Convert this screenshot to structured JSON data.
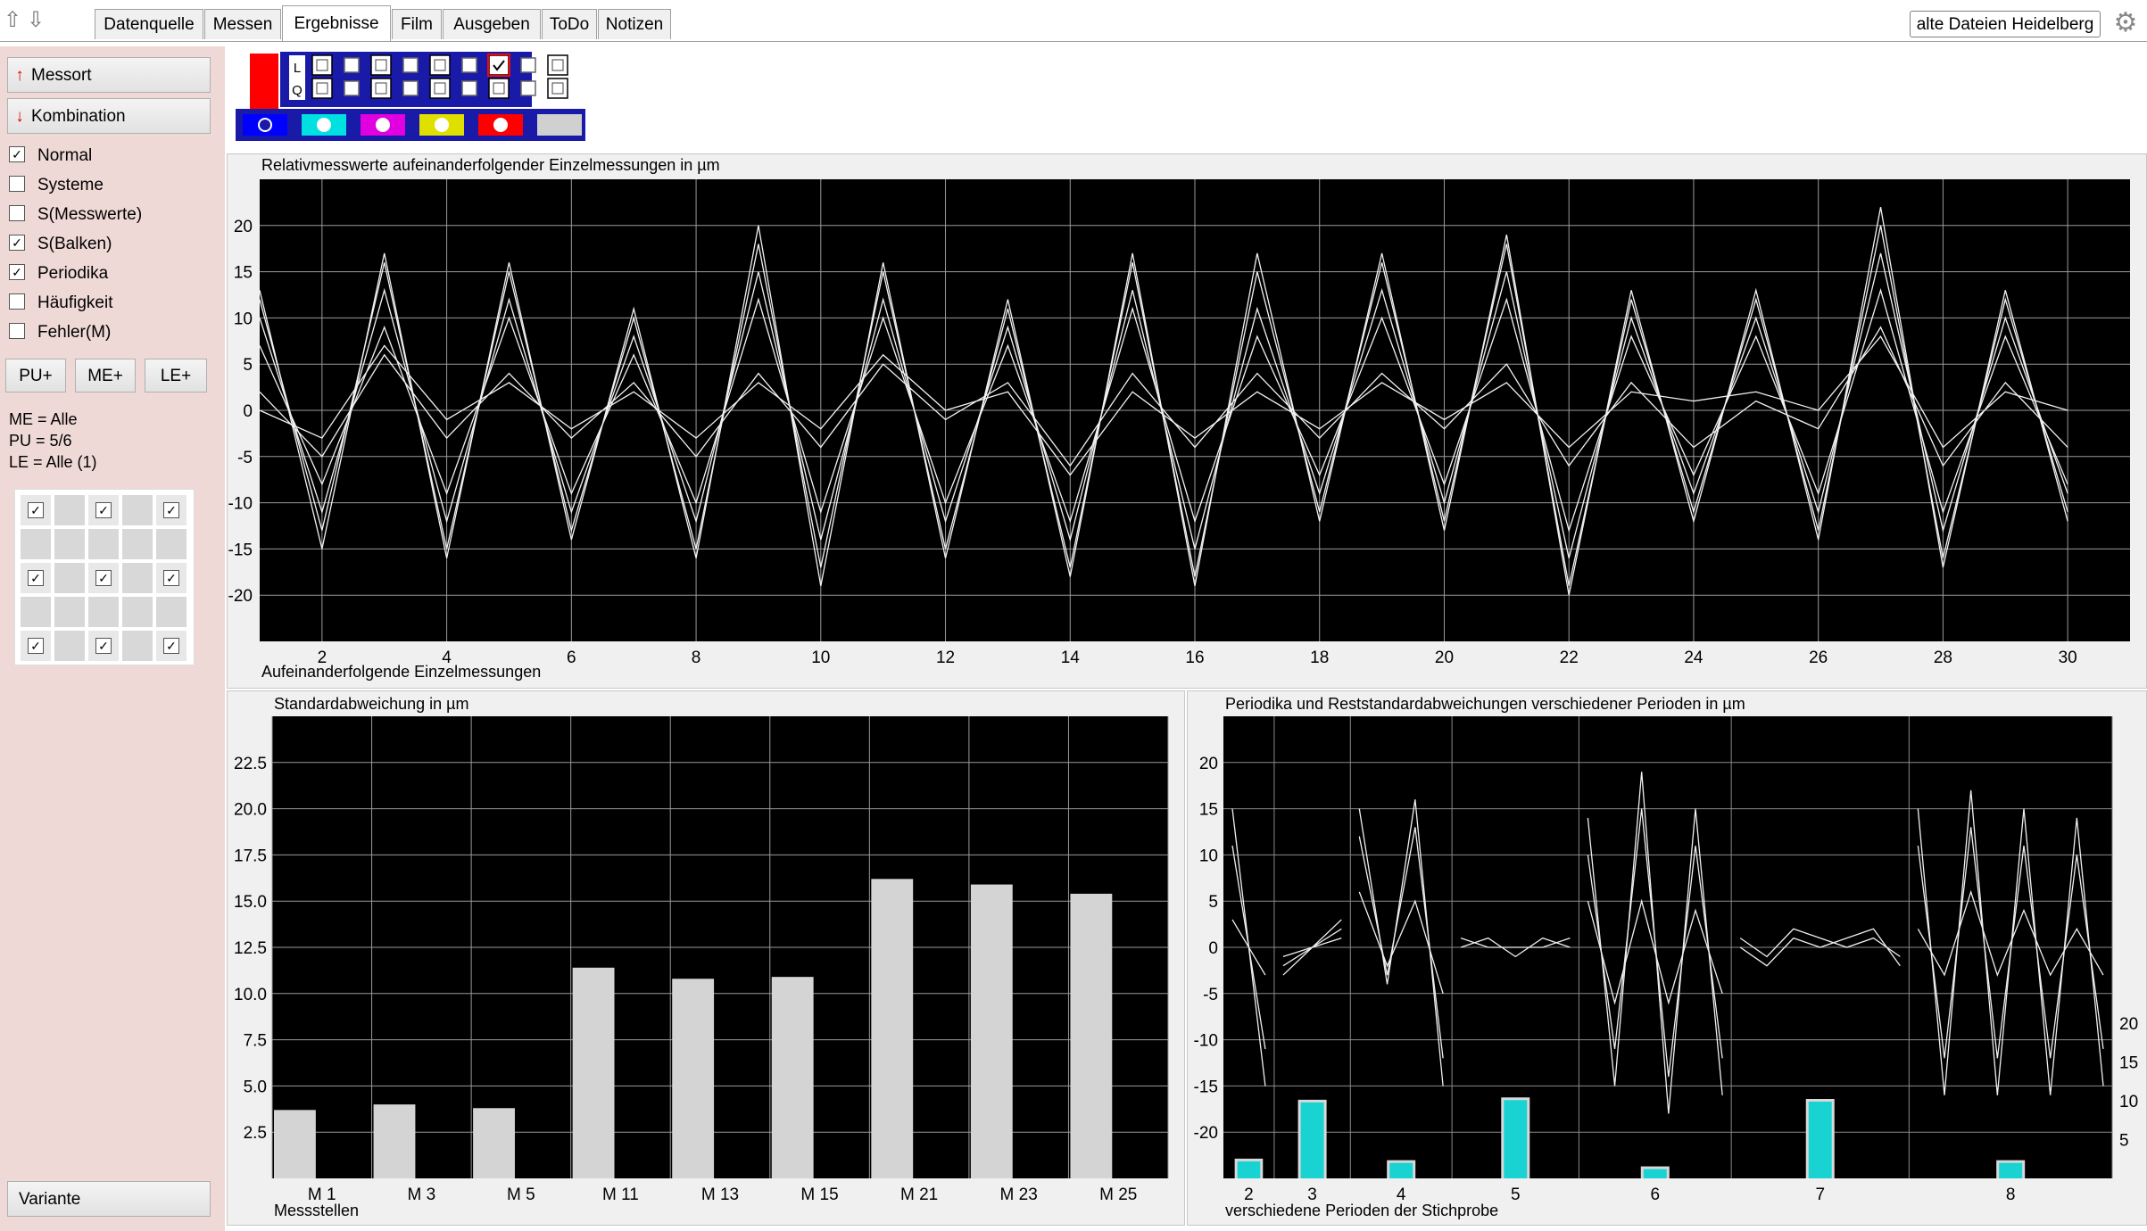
{
  "tabs": [
    {
      "label": "Datenquelle"
    },
    {
      "label": "Messen"
    },
    {
      "label": "Ergebnisse",
      "active": true
    },
    {
      "label": "Film"
    },
    {
      "label": "Ausgeben"
    },
    {
      "label": "ToDo"
    },
    {
      "label": "Notizen"
    }
  ],
  "datafile_label": "alte Dateien Heidelberg",
  "sidebar": {
    "messort_label": "Messort",
    "kombination_label": "Kombination",
    "checkboxes": [
      {
        "label": "Normal",
        "checked": true
      },
      {
        "label": "Systeme",
        "checked": false
      },
      {
        "label": "S(Messwerte)",
        "checked": false
      },
      {
        "label": "S(Balken)",
        "checked": true
      },
      {
        "label": "Periodika",
        "checked": true
      },
      {
        "label": "Häufigkeit",
        "checked": false
      },
      {
        "label": "Fehler(M)",
        "checked": false
      }
    ],
    "buttons": [
      "PU+",
      "ME+",
      "LE+"
    ],
    "info": [
      "ME = Alle",
      "PU = 5/6",
      "LE = Alle (1)"
    ],
    "variante_label": "Variante"
  },
  "legend": {
    "row_labels": [
      "L",
      "Q"
    ],
    "color_swatches": [
      "#0000ff",
      "#00e0e0",
      "#e000e0",
      "#e0e000",
      "#ff0000",
      "#d0d0d0"
    ]
  },
  "chart_data": [
    {
      "type": "line",
      "title": "Relativmesswerte aufeinanderfolgender Einzelmessungen in µm",
      "xlabel": "Aufeinanderfolgende Einzelmessungen",
      "ylabel": "",
      "xlim": [
        1,
        31
      ],
      "ylim": [
        -25,
        25
      ],
      "xticks": [
        2,
        4,
        6,
        8,
        10,
        12,
        14,
        16,
        18,
        20,
        22,
        24,
        26,
        28,
        30
      ],
      "yticks": [
        20,
        15,
        10,
        5,
        0,
        -5,
        -10,
        -15,
        -20
      ],
      "x": [
        1,
        2,
        3,
        4,
        5,
        6,
        7,
        8,
        9,
        10,
        11,
        12,
        13,
        14,
        15,
        16,
        17,
        18,
        19,
        20,
        21,
        22,
        23,
        24,
        25,
        26,
        27,
        28,
        29,
        30
      ],
      "series": [
        {
          "values": [
            13,
            -15,
            17,
            -16,
            16,
            -14,
            11,
            -16,
            20,
            -19,
            16,
            -16,
            12,
            -18,
            17,
            -19,
            17,
            -12,
            17,
            -13,
            19,
            -20,
            13,
            -12,
            13,
            -14,
            22,
            -17,
            13,
            -12
          ]
        },
        {
          "values": [
            12,
            -13,
            16,
            -15,
            15,
            -13,
            10,
            -15,
            18,
            -17,
            15,
            -15,
            11,
            -17,
            16,
            -18,
            15,
            -11,
            16,
            -12,
            18,
            -19,
            12,
            -11,
            12,
            -13,
            20,
            -16,
            12,
            -11
          ]
        },
        {
          "values": [
            10,
            -11,
            13,
            -12,
            12,
            -11,
            8,
            -12,
            15,
            -14,
            12,
            -12,
            9,
            -14,
            13,
            -15,
            11,
            -9,
            13,
            -10,
            15,
            -16,
            10,
            -9,
            10,
            -11,
            17,
            -13,
            10,
            -9
          ]
        },
        {
          "values": [
            7,
            -8,
            9,
            -9,
            10,
            -9,
            6,
            -10,
            12,
            -11,
            10,
            -10,
            7,
            -12,
            11,
            -12,
            8,
            -7,
            10,
            -8,
            12,
            -13,
            8,
            -7,
            8,
            -9,
            13,
            -11,
            8,
            -8
          ]
        },
        {
          "values": [
            2,
            -5,
            6,
            -3,
            4,
            -3,
            3,
            -5,
            4,
            -4,
            5,
            -1,
            3,
            -6,
            4,
            -4,
            4,
            -3,
            4,
            -2,
            5,
            -6,
            3,
            -4,
            1,
            -2,
            9,
            -6,
            3,
            -4
          ]
        },
        {
          "values": [
            0,
            -3,
            7,
            -1,
            3,
            -2,
            2,
            -3,
            3,
            -2,
            6,
            0,
            2,
            -7,
            2,
            -3,
            2,
            -2,
            3,
            -1,
            3,
            -4,
            2,
            1,
            2,
            0,
            8,
            -4,
            2,
            0
          ]
        }
      ]
    },
    {
      "type": "bar",
      "title": "Standardabweichung in µm",
      "xlabel": "Messstellen",
      "ylabel": "",
      "categories": [
        "M 1",
        "M 3",
        "M 5",
        "M 11",
        "M 13",
        "M 15",
        "M 21",
        "M 23",
        "M 25"
      ],
      "values": [
        3.7,
        4.0,
        3.8,
        11.4,
        10.8,
        10.9,
        16.2,
        15.9,
        15.4
      ],
      "ylim": [
        0,
        25
      ],
      "yticks": [
        "2.5",
        "5.0",
        "7.5",
        "10.0",
        "12.5",
        "15.0",
        "17.5",
        "20.0",
        "22.5"
      ]
    },
    {
      "type": "line",
      "title": "Periodika und Reststandardabweichungen verschiedener Perioden in µm",
      "xlabel": "verschiedene Perioden der Stichprobe",
      "ylabel": "",
      "ylim": [
        -25,
        25
      ],
      "yticks": [
        20,
        15,
        10,
        5,
        0,
        -5,
        -10,
        -15,
        -20
      ],
      "right_yticks": [
        20,
        15,
        10,
        5
      ],
      "periods": [
        {
          "period": "2",
          "residual_sd": 2.2,
          "curves": [
            [
              15,
              -15
            ],
            [
              11,
              -11
            ],
            [
              3,
              -3
            ]
          ]
        },
        {
          "period": "3",
          "residual_sd": 9.8,
          "curves": [
            [
              -3,
              0,
              3
            ],
            [
              -2,
              0,
              2
            ],
            [
              -1,
              0,
              1
            ]
          ]
        },
        {
          "period": "4",
          "residual_sd": 2.0,
          "curves": [
            [
              15,
              -4,
              16,
              -15
            ],
            [
              12,
              -3,
              13,
              -12
            ],
            [
              6,
              -2,
              5,
              -5
            ]
          ]
        },
        {
          "period": "5",
          "residual_sd": 10.1,
          "curves": [
            [
              0,
              1,
              -1,
              1,
              0
            ],
            [
              1,
              0,
              0,
              0,
              1
            ]
          ]
        },
        {
          "period": "6",
          "residual_sd": 1.2,
          "curves": [
            [
              14,
              -15,
              19,
              -18,
              15,
              -16
            ],
            [
              10,
              -11,
              15,
              -14,
              11,
              -12
            ],
            [
              5,
              -6,
              5,
              -6,
              4,
              -5
            ]
          ]
        },
        {
          "period": "7",
          "residual_sd": 9.9,
          "curves": [
            [
              0,
              -2,
              1,
              0,
              1,
              2,
              -2
            ],
            [
              1,
              -1,
              2,
              1,
              0,
              1,
              -1
            ]
          ]
        },
        {
          "period": "8",
          "residual_sd": 2.0,
          "curves": [
            [
              15,
              -16,
              17,
              -16,
              15,
              -16,
              14,
              -15
            ],
            [
              11,
              -12,
              13,
              -12,
              11,
              -12,
              10,
              -11
            ],
            [
              2,
              -3,
              6,
              -3,
              4,
              -3,
              2,
              -3
            ]
          ]
        }
      ]
    }
  ]
}
